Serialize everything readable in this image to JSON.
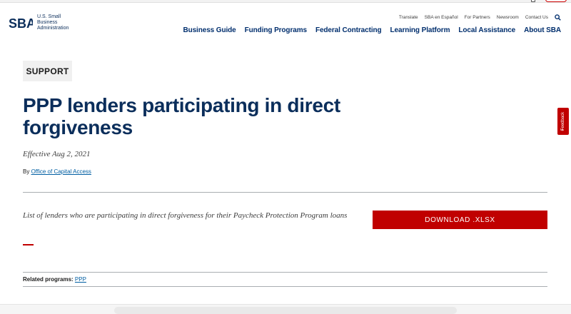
{
  "colors": {
    "navy": "#0b2e5b",
    "accent_red": "#c00000",
    "link_blue": "#005ea2"
  },
  "header": {
    "logo": {
      "mark": "SBA",
      "org_name": "U.S. Small Business Administration"
    },
    "utility_nav": [
      "Translate",
      "SBA en Español",
      "For Partners",
      "Newsroom",
      "Contact Us"
    ],
    "search_icon": "search-icon",
    "main_nav": [
      "Business Guide",
      "Funding Programs",
      "Federal Contracting",
      "Learning Platform",
      "Local Assistance",
      "About SBA"
    ]
  },
  "content": {
    "badge": "SUPPORT",
    "title": "PPP lenders participating in direct forgiveness",
    "effective": "Effective Aug 2, 2021",
    "byline_prefix": "By",
    "byline_link": "Office of Capital Access",
    "summary": "List of lenders who are participating in direct forgiveness for their Paycheck Protection Program loans",
    "download_label": "DOWNLOAD .XLSX",
    "related_label": "Related programs:",
    "related_link": "PPP"
  },
  "feedback": {
    "label": "Feedback"
  }
}
